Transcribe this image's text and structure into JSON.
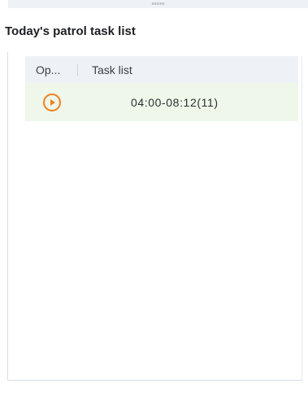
{
  "panel": {
    "title": "Today's patrol task list"
  },
  "table": {
    "headers": {
      "operation": "Op...",
      "task_list": "Task list"
    },
    "rows": [
      {
        "action_icon": "play-circle-icon",
        "time_range": "04:00-08:12(11)"
      }
    ]
  },
  "colors": {
    "accent": "#f07f1e",
    "header_bg": "#eef1f6",
    "row_bg": "#eef7e9"
  }
}
